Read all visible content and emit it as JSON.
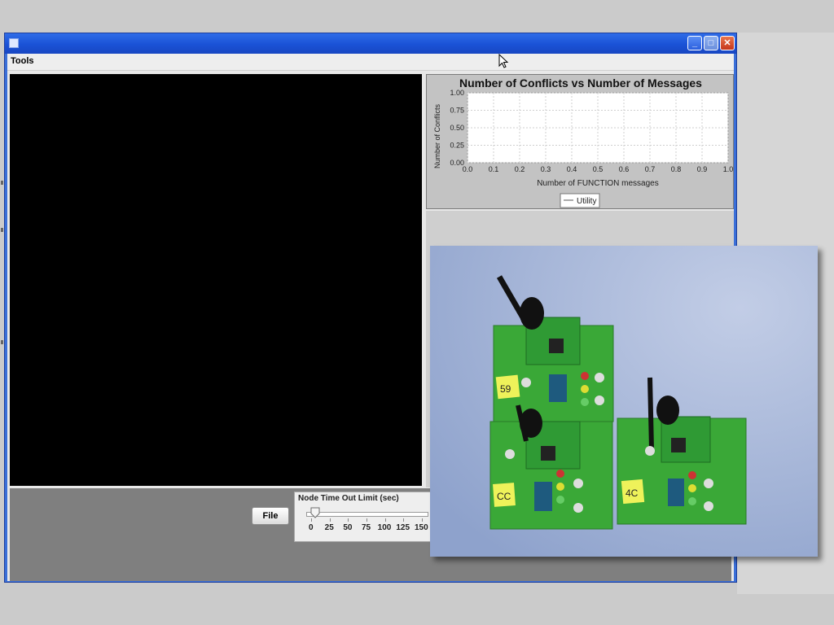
{
  "window": {
    "menu": [
      "Tools"
    ],
    "controls": {
      "minimize": "minimize-icon",
      "maximize": "maximize-icon",
      "close": "close-icon"
    }
  },
  "chart": {
    "legend": [
      "Utility"
    ]
  },
  "chart_data": {
    "type": "line",
    "title": "Number of Conflicts vs Number of Messages",
    "xlabel": "Number of FUNCTION messages",
    "ylabel": "Number of Conflicts",
    "xlim": [
      0.0,
      1.0
    ],
    "ylim": [
      0.0,
      1.0
    ],
    "x_ticks": [
      "0.0",
      "0.1",
      "0.2",
      "0.3",
      "0.4",
      "0.5",
      "0.6",
      "0.7",
      "0.8",
      "0.9",
      "1.0"
    ],
    "y_ticks": [
      "0.00",
      "0.25",
      "0.50",
      "0.75",
      "1.00"
    ],
    "grid": true,
    "legend_position": "bottom",
    "series": [
      {
        "name": "Utility",
        "x": [],
        "y": []
      }
    ]
  },
  "controls": {
    "file_button": "File",
    "slider": {
      "title": "Node Time Out Limit (sec)",
      "tick_labels": [
        "0",
        "25",
        "50",
        "75",
        "100",
        "125",
        "150"
      ],
      "value": 5,
      "min": 0,
      "max": 150
    }
  },
  "photo": {
    "labels": [
      "59",
      "CC",
      "4C"
    ]
  },
  "colors": {
    "titlebar": "#1a52d6",
    "close_button": "#c5361a",
    "pcb_green": "#3ba83a",
    "note_yellow": "#eef25a"
  }
}
